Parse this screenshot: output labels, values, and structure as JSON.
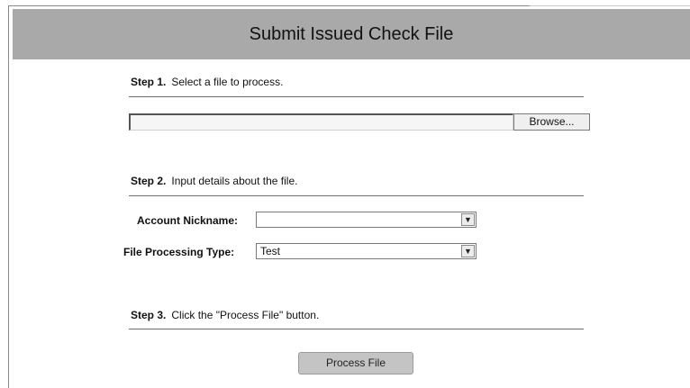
{
  "header": {
    "title": "Submit Issued Check File"
  },
  "step1": {
    "number": "Step 1.",
    "text": "Select a file to process."
  },
  "file_picker": {
    "value": "",
    "browse_label": "Browse..."
  },
  "step2": {
    "number": "Step 2.",
    "text": "Input details about the file."
  },
  "fields": {
    "account_nickname_label": "Account Nickname:",
    "account_nickname_value": "",
    "processing_type_label": "File Processing Type:",
    "processing_type_value": "Test"
  },
  "step3": {
    "number": "Step 3.",
    "text": "Click the \"Process File\" button."
  },
  "actions": {
    "process_label": "Process File"
  },
  "icons": {
    "dropdown_arrow": "chevron-down-icon"
  }
}
